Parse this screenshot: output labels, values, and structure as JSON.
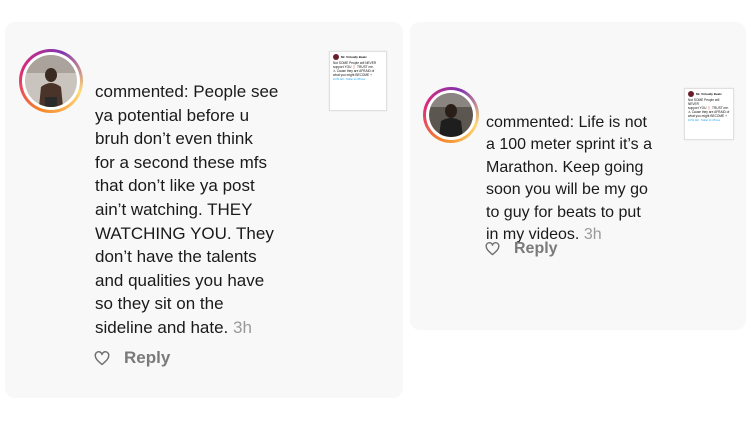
{
  "comments": [
    {
      "prefix": "commented:",
      "lines": [
        "People see",
        "ya potential before u",
        "bruh don’t even think",
        "for a second these mfs",
        "that don’t like ya post",
        "ain’t watching. THEY",
        "WATCHING YOU. They",
        "don’t have the talents",
        "and qualities you have",
        "so they sit on the",
        "sideline and hate."
      ],
      "time": "3h",
      "reply_label": "Reply",
      "heart_icon": "heart-outline-icon"
    },
    {
      "prefix": "commented:",
      "lines": [
        "Life is not",
        "a 100 meter sprint it’s a",
        "Marathon. Keep going",
        "soon you will be my go",
        "to guy for beats to put",
        "in my videos."
      ],
      "time": "3h",
      "reply_label": "Reply",
      "heart_icon": "heart-outline-icon"
    }
  ],
  "tweet_thumbnail": {
    "author": "Mr. Virtually Beatz",
    "text": "Not SOME People will NEVER\nsupport YOU ❗ TRUST me.\n⚠ Cause they are AFRAID of\nwhat you might BECOME ⚡",
    "meta": "10:51 AM · Twitter for iPhone"
  },
  "colors": {
    "card_bg": "#f8f8f8",
    "timestamp": "#9a9a9a",
    "reply": "#7a7a7a",
    "ring": [
      "#f58529",
      "#dd2a7b",
      "#8134af",
      "#feda77"
    ]
  }
}
